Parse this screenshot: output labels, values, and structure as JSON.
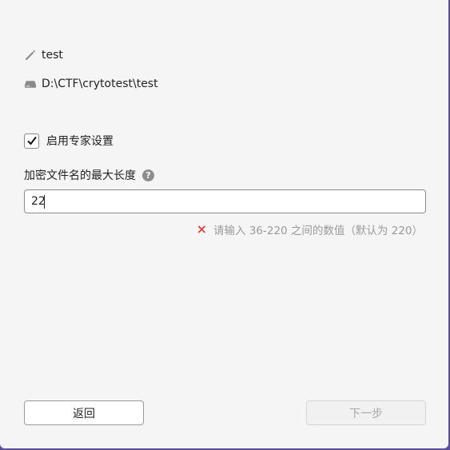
{
  "info": {
    "name": "test",
    "path": "D:\\CTF\\crytotest\\test"
  },
  "expert": {
    "checkbox_label": "启用专家设置",
    "checked": true
  },
  "max_length": {
    "label": "加密文件名的最大长度",
    "help_glyph": "?",
    "value": "22",
    "error_icon": "×",
    "error": "请输入 36-220 之间的数值（默认为 220）"
  },
  "buttons": {
    "back": "返回",
    "next": "下一步"
  },
  "colors": {
    "error": "#e0443e",
    "accent_border": "#5b4f9e"
  }
}
